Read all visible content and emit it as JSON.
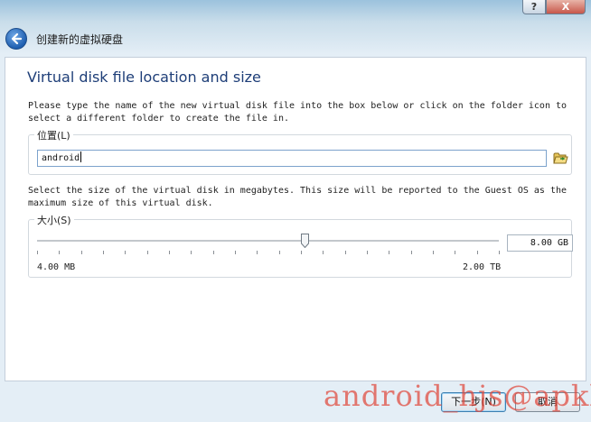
{
  "window": {
    "help_label": "?",
    "close_label": "X"
  },
  "header": {
    "title": "创建新的虚拟硬盘"
  },
  "main": {
    "heading": "Virtual disk file location and size",
    "location_description": "Please type the name of the new virtual disk file into the box below or click on the folder icon to select a different folder to create the file in.",
    "location_group_label": "位置(L)",
    "location_value": "android",
    "size_description": "Select the size of the virtual disk in megabytes. This size will be reported to the Guest OS as the maximum size of this virtual disk.",
    "size_group_label": "大小(S)",
    "size_value": "8.00 GB",
    "size_min_label": "4.00 MB",
    "size_max_label": "2.00 TB",
    "slider_position_fraction": 0.58
  },
  "footer": {
    "next_label": "下一步(N)",
    "cancel_label": "取消"
  },
  "watermark": {
    "text": "android_hjs@apkbus"
  },
  "colors": {
    "accent": "#1e3e78",
    "watermark": "#e0483c"
  },
  "icons": [
    "back-arrow-icon",
    "folder-open-icon",
    "help-icon",
    "close-icon"
  ]
}
